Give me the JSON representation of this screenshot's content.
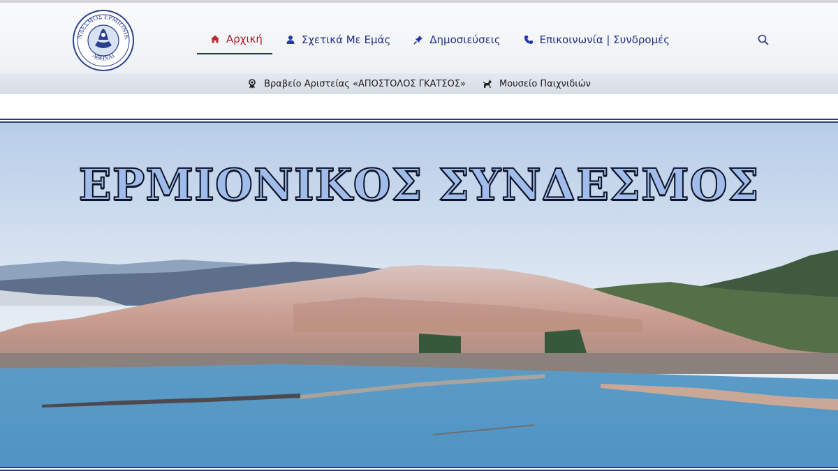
{
  "logo": {
    "top_text": "ΣΥΝΔΕΣΜΟΣ ΕΡΜΙΟΝΙΚΟΣ",
    "bottom_text": "ΑΘΗΝΑΙ"
  },
  "nav": {
    "items": [
      {
        "label": "Αρχική",
        "icon": "home-icon",
        "active": true
      },
      {
        "label": "Σχετικά Με Εμάς",
        "icon": "user-icon",
        "active": false
      },
      {
        "label": "Δημοσιεύσεις",
        "icon": "pin-icon",
        "active": false
      },
      {
        "label": "Επικοινωνία | Συνδρομές",
        "icon": "phone-icon",
        "active": false
      }
    ],
    "search_icon": "search-icon"
  },
  "subnav": {
    "items": [
      {
        "label": "Βραβείο Αριστείας «ΑΠΟΣΤΟΛΟΣ ΓΚΑΤΣΟΣ»",
        "icon": "award-icon"
      },
      {
        "label": "Μουσείο Παιχνιδιών",
        "icon": "horse-icon"
      }
    ]
  },
  "hero": {
    "title": "ΕΡΜΙΟΝΙΚΟΣ ΣΥΝΔΕΣΜΟΣ"
  },
  "colors": {
    "nav_text": "#1f2f86",
    "active_text": "#a61d24",
    "frame": "#2c3e78",
    "title_fill": "#9fbcea"
  }
}
